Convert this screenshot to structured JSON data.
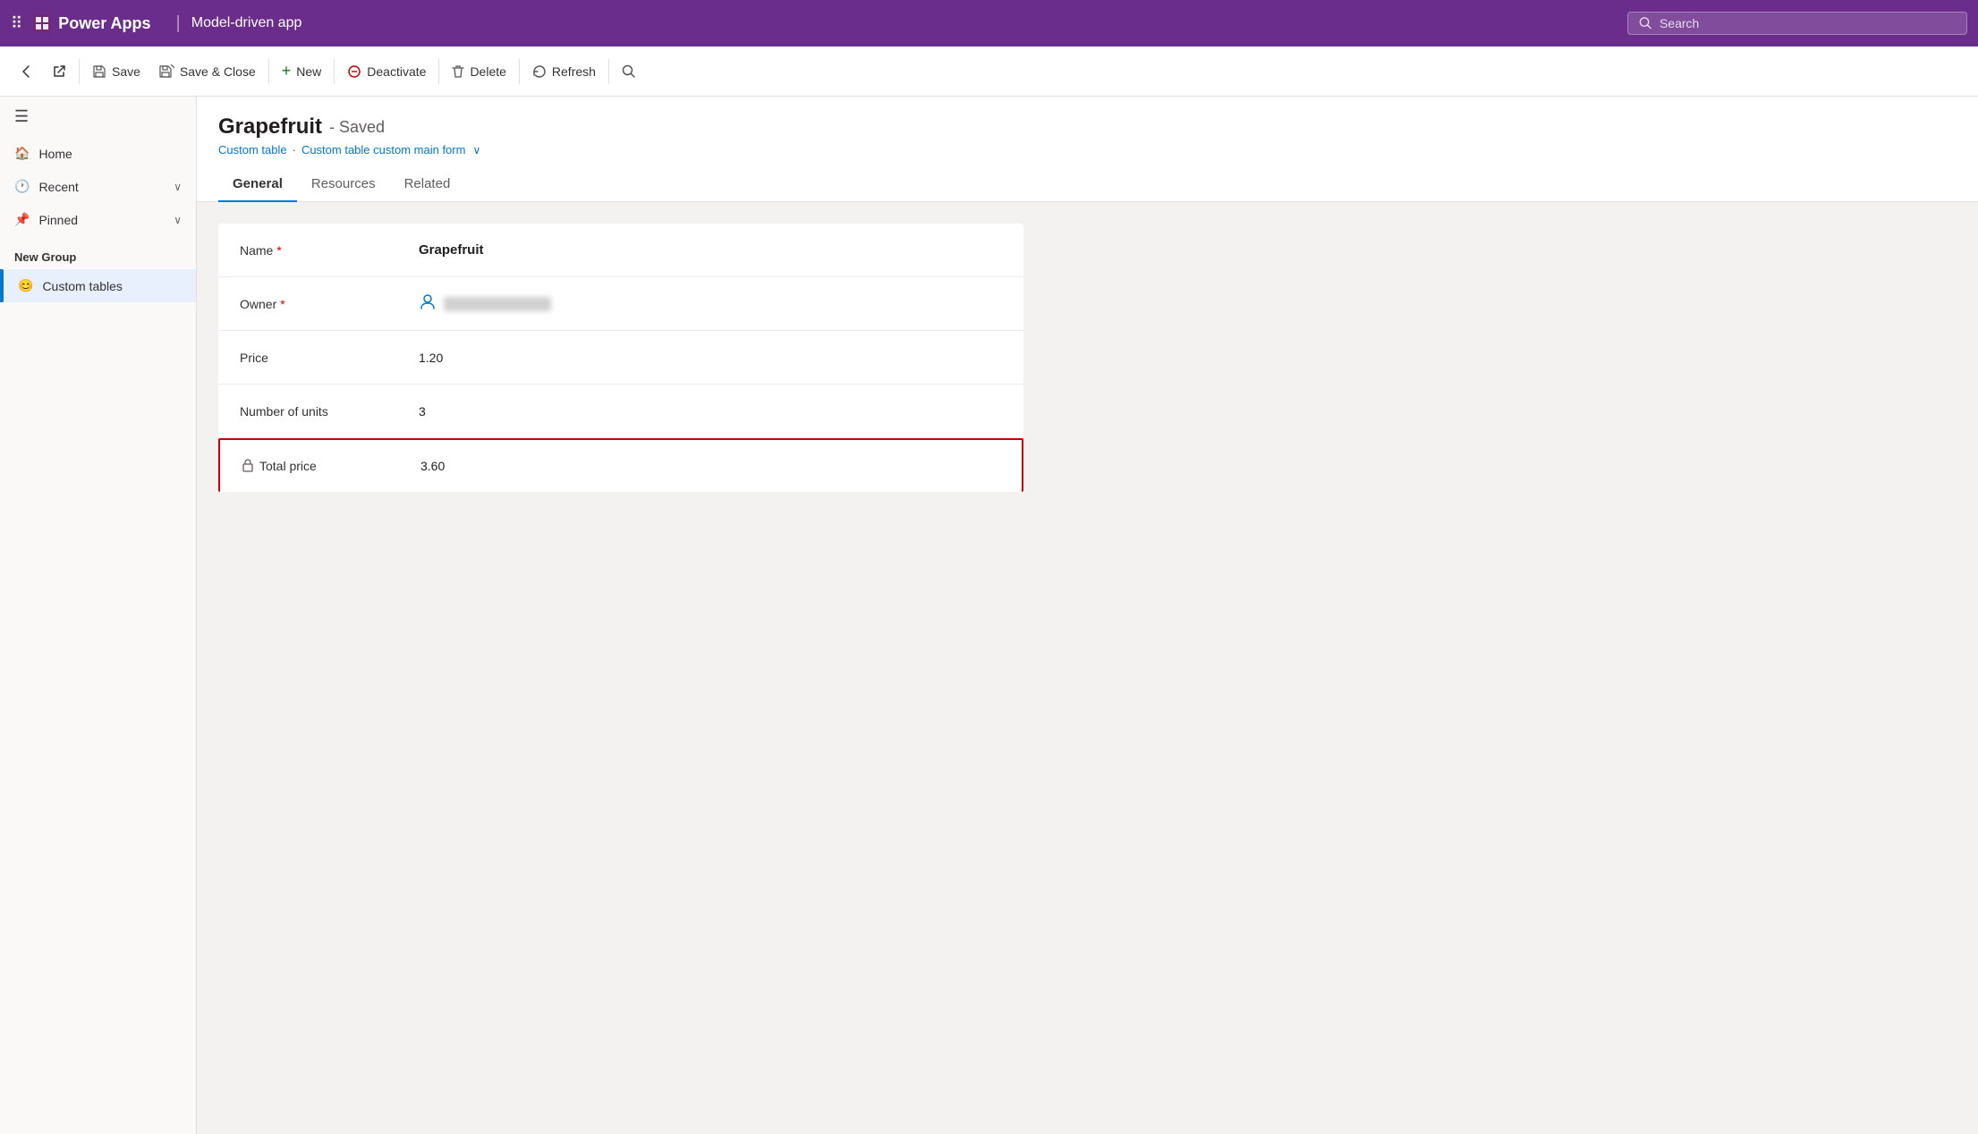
{
  "topbar": {
    "waffle": "⠿",
    "logo": "Power Apps",
    "divider": "|",
    "app_name": "Model-driven app",
    "search_placeholder": "Search"
  },
  "toolbar": {
    "back_label": "",
    "external_label": "",
    "save_label": "Save",
    "save_close_label": "Save & Close",
    "new_label": "New",
    "deactivate_label": "Deactivate",
    "delete_label": "Delete",
    "refresh_label": "Refresh",
    "search_label": ""
  },
  "sidebar": {
    "menu_icon": "☰",
    "items": [
      {
        "id": "home",
        "label": "Home",
        "icon": "🏠"
      },
      {
        "id": "recent",
        "label": "Recent",
        "icon": "🕐",
        "hasChevron": true
      },
      {
        "id": "pinned",
        "label": "Pinned",
        "icon": "📌",
        "hasChevron": true
      }
    ],
    "section_label": "New Group",
    "nav_items": [
      {
        "id": "custom-tables",
        "label": "Custom tables",
        "icon": "😊",
        "active": true
      }
    ]
  },
  "record": {
    "title": "Grapefruit",
    "status": "- Saved",
    "breadcrumb_table": "Custom table",
    "breadcrumb_sep": "·",
    "breadcrumb_form": "Custom table custom main form",
    "breadcrumb_chevron": "∨"
  },
  "tabs": [
    {
      "id": "general",
      "label": "General",
      "active": true
    },
    {
      "id": "resources",
      "label": "Resources",
      "active": false
    },
    {
      "id": "related",
      "label": "Related",
      "active": false
    }
  ],
  "form": {
    "fields": [
      {
        "id": "name",
        "label": "Name",
        "required": true,
        "value": "Grapefruit",
        "bold": true,
        "type": "text"
      },
      {
        "id": "owner",
        "label": "Owner",
        "required": true,
        "value": "",
        "type": "owner"
      },
      {
        "id": "price",
        "label": "Price",
        "required": false,
        "value": "1.20",
        "type": "text"
      },
      {
        "id": "number_of_units",
        "label": "Number of units",
        "required": false,
        "value": "3",
        "type": "text"
      },
      {
        "id": "total_price",
        "label": "Total price",
        "required": false,
        "value": "3.60",
        "type": "locked",
        "highlighted": true
      }
    ]
  }
}
